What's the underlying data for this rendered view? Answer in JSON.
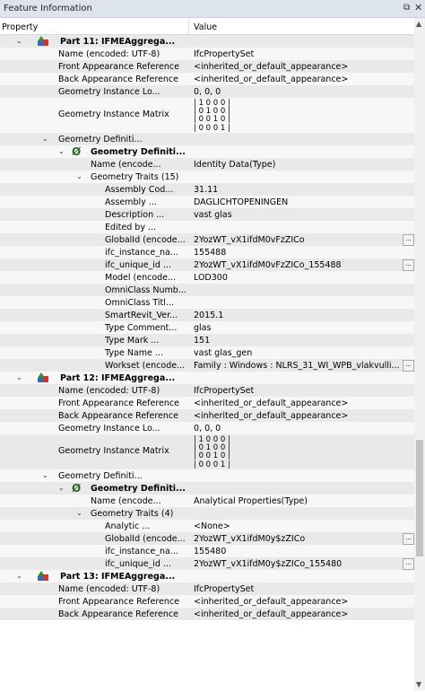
{
  "window": {
    "title": "Feature Information",
    "float_glyph": "⧉",
    "close_glyph": "✕"
  },
  "columns": {
    "property": "Property",
    "value": "Value"
  },
  "rows": [
    {
      "p": "Part 11: IFMEAggrega...",
      "bold": true,
      "exp": "⌄",
      "icon": "fme",
      "lvl": 0,
      "v": ""
    },
    {
      "p": "Name (encoded: UTF-8)",
      "lvl": 1,
      "v": "IfcPropertySet"
    },
    {
      "p": "Front Appearance Reference",
      "lvl": 1,
      "v": "<inherited_or_default_appearance>"
    },
    {
      "p": "Back Appearance Reference",
      "lvl": 1,
      "v": "<inherited_or_default_appearance>"
    },
    {
      "p": "Geometry Instance Lo...",
      "lvl": 1,
      "v": "0, 0, 0"
    },
    {
      "p": "Geometry Instance Matrix",
      "lvl": 1,
      "tall": true,
      "v": "| 1 0 0 0 |\n| 0 1 0 0 |\n| 0 0 1 0 |\n| 0 0 0 1 |"
    },
    {
      "p": "Geometry Definiti...",
      "exp": "⌄",
      "lvl": 1,
      "v": ""
    },
    {
      "p": "Geometry Definiti...",
      "bold": true,
      "exp": "⌄",
      "icon": "null",
      "lvl": 2,
      "v": ""
    },
    {
      "p": "Name (encode...",
      "lvl": 3,
      "v": "Identity Data(Type)"
    },
    {
      "p": "Geometry Traits (15)",
      "exp": "⌄",
      "lvl": 3,
      "v": ""
    },
    {
      "p": "Assembly Cod...",
      "lvl": 4,
      "v": "31.11"
    },
    {
      "p": "Assembly ...",
      "lvl": 4,
      "v": "DAGLICHTOPENINGEN"
    },
    {
      "p": "Description ...",
      "lvl": 4,
      "v": "vast glas"
    },
    {
      "p": "Edited by ...",
      "lvl": 4,
      "v": ""
    },
    {
      "p": "GlobalId (encode...",
      "lvl": 4,
      "v": "2YozWT_vX1ifdM0vFzZICo",
      "ell": true
    },
    {
      "p": "ifc_instance_na...",
      "lvl": 4,
      "v": "155488"
    },
    {
      "p": "ifc_unique_id ...",
      "lvl": 4,
      "v": "2YozWT_vX1ifdM0vFzZICo_155488",
      "ell": true
    },
    {
      "p": "Model (encode...",
      "lvl": 4,
      "v": "LOD300"
    },
    {
      "p": "OmniClass Numb...",
      "lvl": 4,
      "v": ""
    },
    {
      "p": "OmniClass Titl...",
      "lvl": 4,
      "v": ""
    },
    {
      "p": "SmartRevit_Ver...",
      "lvl": 4,
      "v": "2015.1"
    },
    {
      "p": "Type Comment...",
      "lvl": 4,
      "v": "glas"
    },
    {
      "p": "Type Mark ...",
      "lvl": 4,
      "v": "151"
    },
    {
      "p": "Type Name ...",
      "lvl": 4,
      "v": "vast glas_gen"
    },
    {
      "p": "Workset (encode...",
      "lvl": 4,
      "v": "Family : Windows : NLRS_31_WI_WPB_vlakvulli...",
      "ell": true
    },
    {
      "p": "Part 12: IFMEAggrega...",
      "bold": true,
      "exp": "⌄",
      "icon": "fme",
      "lvl": 0,
      "v": ""
    },
    {
      "p": "Name (encoded: UTF-8)",
      "lvl": 1,
      "v": "IfcPropertySet"
    },
    {
      "p": "Front Appearance Reference",
      "lvl": 1,
      "v": "<inherited_or_default_appearance>"
    },
    {
      "p": "Back Appearance Reference",
      "lvl": 1,
      "v": "<inherited_or_default_appearance>"
    },
    {
      "p": "Geometry Instance Lo...",
      "lvl": 1,
      "v": "0, 0, 0"
    },
    {
      "p": "Geometry Instance Matrix",
      "lvl": 1,
      "tall": true,
      "v": "| 1 0 0 0 |\n| 0 1 0 0 |\n| 0 0 1 0 |\n| 0 0 0 1 |"
    },
    {
      "p": "Geometry Definiti...",
      "exp": "⌄",
      "lvl": 1,
      "v": ""
    },
    {
      "p": "Geometry Definiti...",
      "bold": true,
      "exp": "⌄",
      "icon": "null",
      "lvl": 2,
      "v": ""
    },
    {
      "p": "Name (encode...",
      "lvl": 3,
      "v": "Analytical Properties(Type)"
    },
    {
      "p": "Geometry Traits (4)",
      "exp": "⌄",
      "lvl": 3,
      "v": ""
    },
    {
      "p": "Analytic ...",
      "lvl": 4,
      "v": "<None>"
    },
    {
      "p": "GlobalId (encode...",
      "lvl": 4,
      "v": "2YozWT_vX1ifdM0y$zZICo",
      "ell": true
    },
    {
      "p": "ifc_instance_na...",
      "lvl": 4,
      "v": "155480"
    },
    {
      "p": "ifc_unique_id ...",
      "lvl": 4,
      "v": "2YozWT_vX1ifdM0y$zZICo_155480",
      "ell": true
    },
    {
      "p": "Part 13: IFMEAggrega...",
      "bold": true,
      "exp": "⌄",
      "icon": "fme",
      "lvl": 0,
      "v": ""
    },
    {
      "p": "Name (encoded: UTF-8)",
      "lvl": 1,
      "v": "IfcPropertySet"
    },
    {
      "p": "Front Appearance Reference",
      "lvl": 1,
      "v": "<inherited_or_default_appearance>"
    },
    {
      "p": "Back Appearance Reference",
      "lvl": 1,
      "v": "<inherited_or_default_appearance>"
    }
  ],
  "ellipsis_label": "..."
}
